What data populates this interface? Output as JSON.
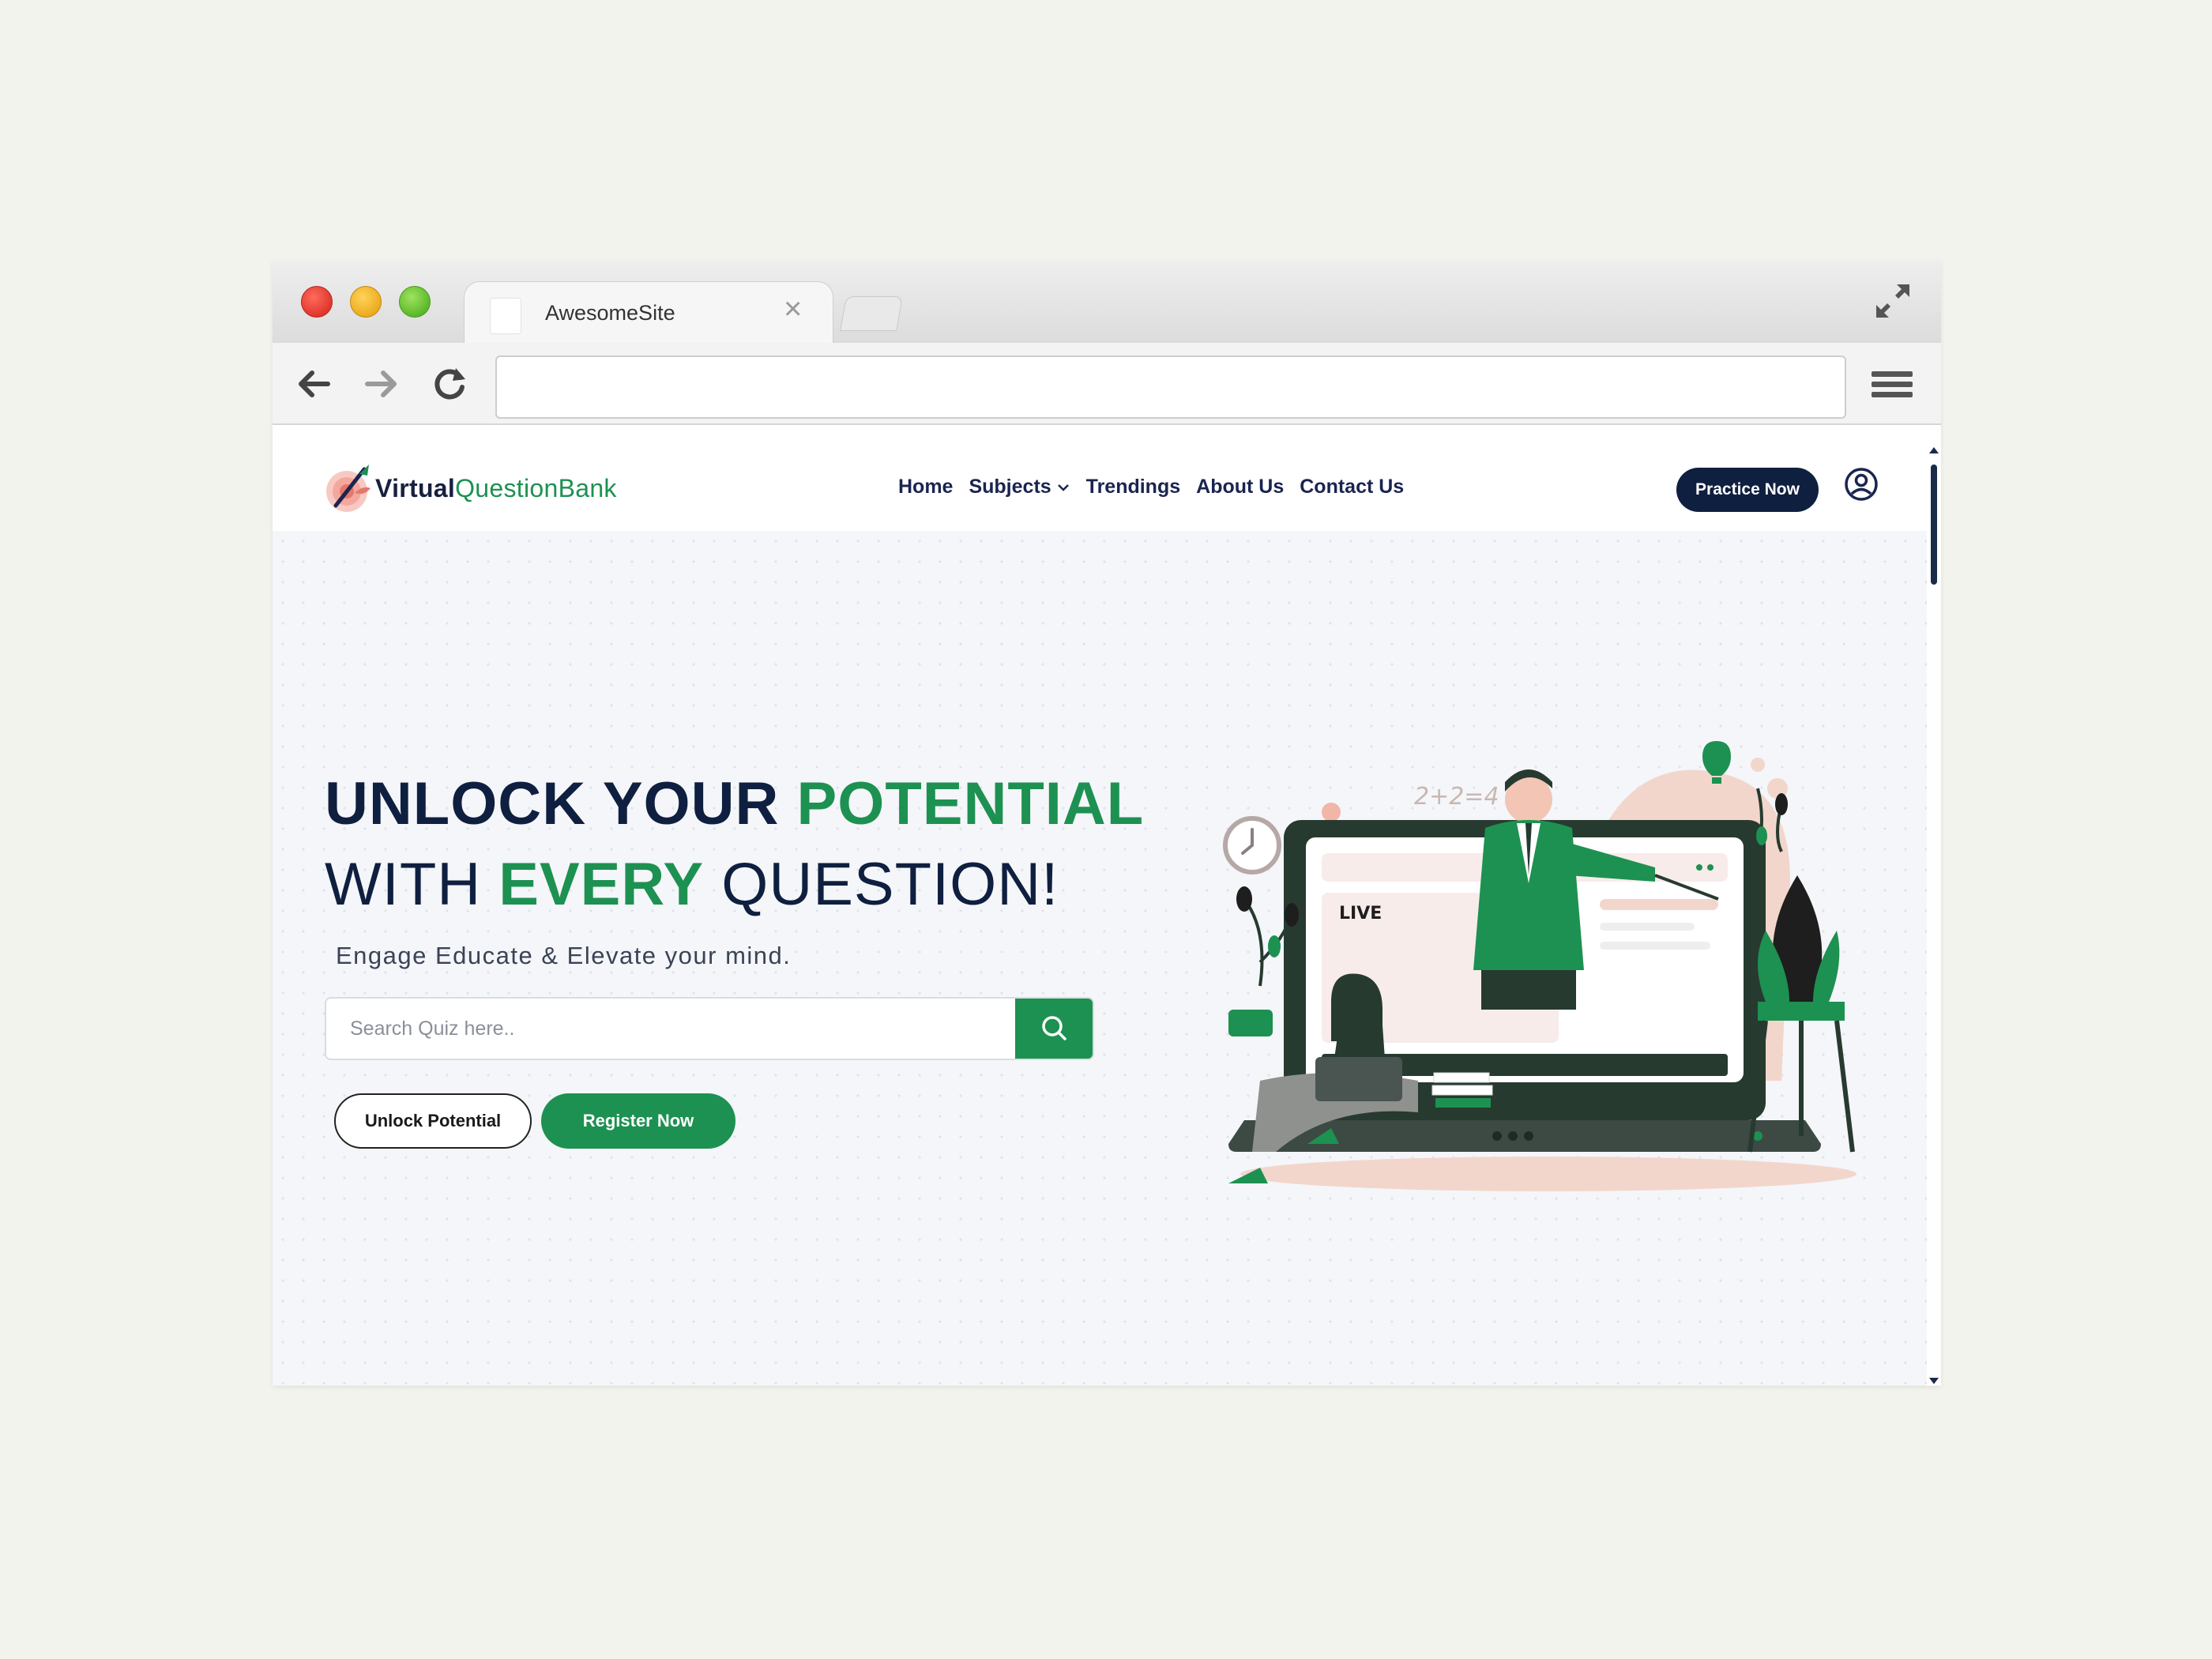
{
  "browser": {
    "tab_title": "AwesomeSite",
    "url": ""
  },
  "site": {
    "logo_bold": "Virtual",
    "logo_rest": "QuestionBank",
    "nav": [
      {
        "label": "Home"
      },
      {
        "label": "Subjects"
      },
      {
        "label": "Trendings"
      },
      {
        "label": "About Us"
      },
      {
        "label": "Contact Us"
      }
    ],
    "practice_label": "Practice Now"
  },
  "hero": {
    "line1_a": "UNLOCK YOUR ",
    "line1_b": "POTENTIAL",
    "line2_a": "WITH ",
    "line2_b": "EVERY",
    "line2_c": " QUESTION!",
    "subtitle": "Engage Educate & Elevate your mind.",
    "search_placeholder": "Search Quiz here..",
    "search_value": "",
    "btn_outline": "Unlock Potential",
    "btn_primary": "Register Now",
    "illustration_texts": {
      "equation": "2+2=4",
      "live": "LIVE"
    }
  },
  "colors": {
    "brand_green": "#1d9151",
    "brand_navy": "#0f1f3f",
    "accent_pink": "#f2d6cc"
  },
  "icons": [
    "back-arrow-icon",
    "forward-arrow-icon",
    "reload-icon",
    "hamburger-menu-icon",
    "expand-icon",
    "search-icon",
    "user-circle-icon",
    "chevron-down-icon"
  ]
}
